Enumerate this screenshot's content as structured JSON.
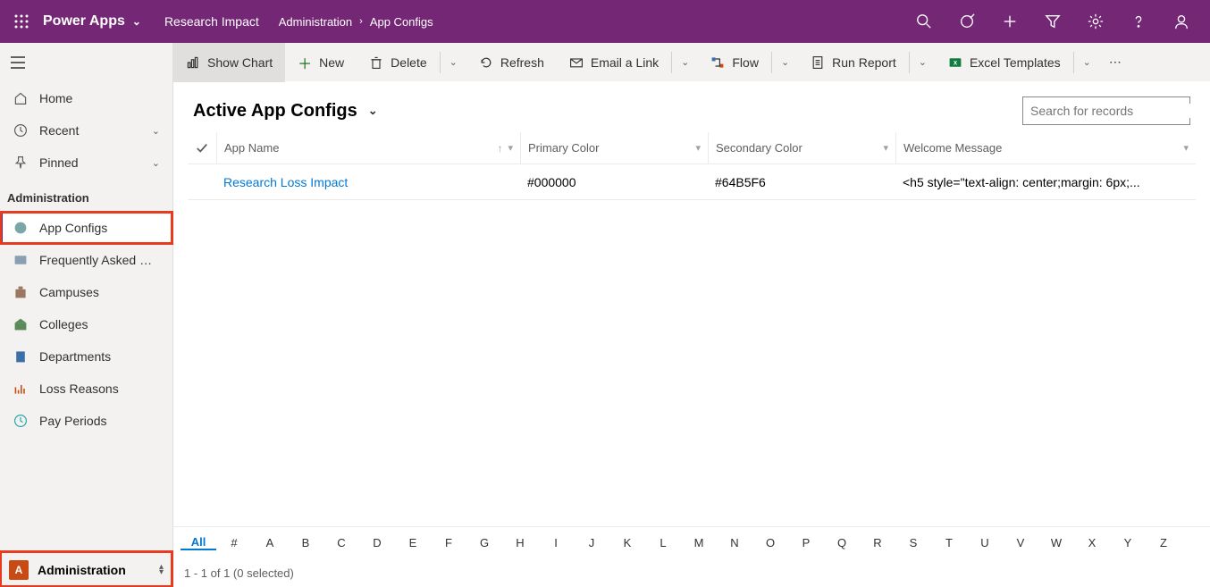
{
  "header": {
    "app_name": "Power Apps",
    "environment": "Research Impact",
    "breadcrumb": [
      "Administration",
      "App Configs"
    ]
  },
  "sidebar": {
    "top": [
      {
        "label": "Home",
        "icon": "home"
      },
      {
        "label": "Recent",
        "icon": "clock",
        "expandable": true
      },
      {
        "label": "Pinned",
        "icon": "pin",
        "expandable": true
      }
    ],
    "group_title": "Administration",
    "items": [
      {
        "label": "App Configs",
        "icon": "config",
        "active": true,
        "highlighted": true
      },
      {
        "label": "Frequently Asked Qu...",
        "icon": "faq"
      },
      {
        "label": "Campuses",
        "icon": "campus"
      },
      {
        "label": "Colleges",
        "icon": "college"
      },
      {
        "label": "Departments",
        "icon": "dept"
      },
      {
        "label": "Loss Reasons",
        "icon": "loss"
      },
      {
        "label": "Pay Periods",
        "icon": "pay"
      }
    ],
    "area": {
      "letter": "A",
      "label": "Administration",
      "highlighted": true
    }
  },
  "commandbar": [
    {
      "label": "Show Chart",
      "icon": "chart",
      "active": true
    },
    {
      "label": "New",
      "icon": "plus"
    },
    {
      "label": "Delete",
      "icon": "trash",
      "split": true
    },
    {
      "label": "Refresh",
      "icon": "refresh"
    },
    {
      "label": "Email a Link",
      "icon": "mail",
      "split": true
    },
    {
      "label": "Flow",
      "icon": "flow",
      "split": true
    },
    {
      "label": "Run Report",
      "icon": "report",
      "split": true
    },
    {
      "label": "Excel Templates",
      "icon": "excel",
      "split": true
    }
  ],
  "view": {
    "title": "Active App Configs",
    "search_placeholder": "Search for records"
  },
  "grid": {
    "columns": [
      "App Name",
      "Primary Color",
      "Secondary Color",
      "Welcome Message"
    ],
    "rows": [
      {
        "name": "Research Loss Impact",
        "primary": "#000000",
        "secondary": "#64B5F6",
        "welcome": "<h5 style=\"text-align: center;margin: 6px;..."
      }
    ]
  },
  "alpha": [
    "All",
    "#",
    "A",
    "B",
    "C",
    "D",
    "E",
    "F",
    "G",
    "H",
    "I",
    "J",
    "K",
    "L",
    "M",
    "N",
    "O",
    "P",
    "Q",
    "R",
    "S",
    "T",
    "U",
    "V",
    "W",
    "X",
    "Y",
    "Z"
  ],
  "status": "1 - 1 of 1 (0 selected)"
}
